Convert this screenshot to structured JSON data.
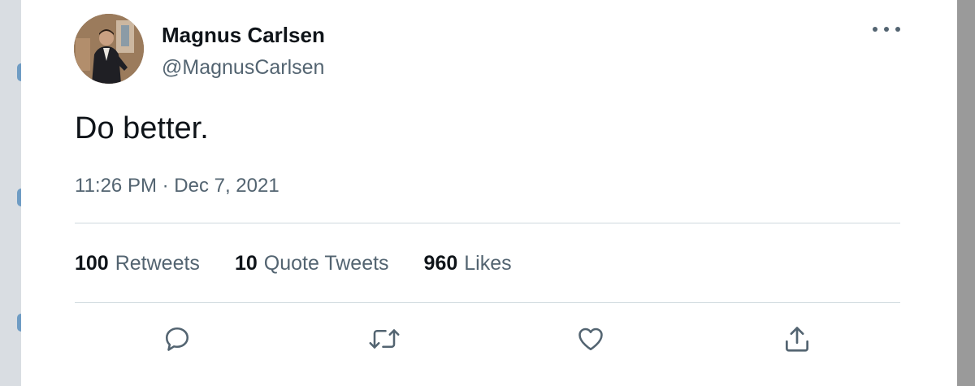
{
  "tweet": {
    "author_name": "Magnus Carlsen",
    "author_handle": "@MagnusCarlsen",
    "text": "Do better.",
    "timestamp": "11:26 PM · Dec 7, 2021"
  },
  "stats": [
    {
      "count": "100",
      "label": "Retweets"
    },
    {
      "count": "10",
      "label": "Quote Tweets"
    },
    {
      "count": "960",
      "label": "Likes"
    }
  ],
  "actions": {
    "reply_icon": "speech-bubble",
    "retweet_icon": "retweet-arrows",
    "like_icon": "heart",
    "share_icon": "upload-arrow"
  },
  "colors": {
    "text_primary": "#0f1419",
    "text_secondary": "#536471",
    "divider": "#cfd9de",
    "background": "#ffffff"
  }
}
